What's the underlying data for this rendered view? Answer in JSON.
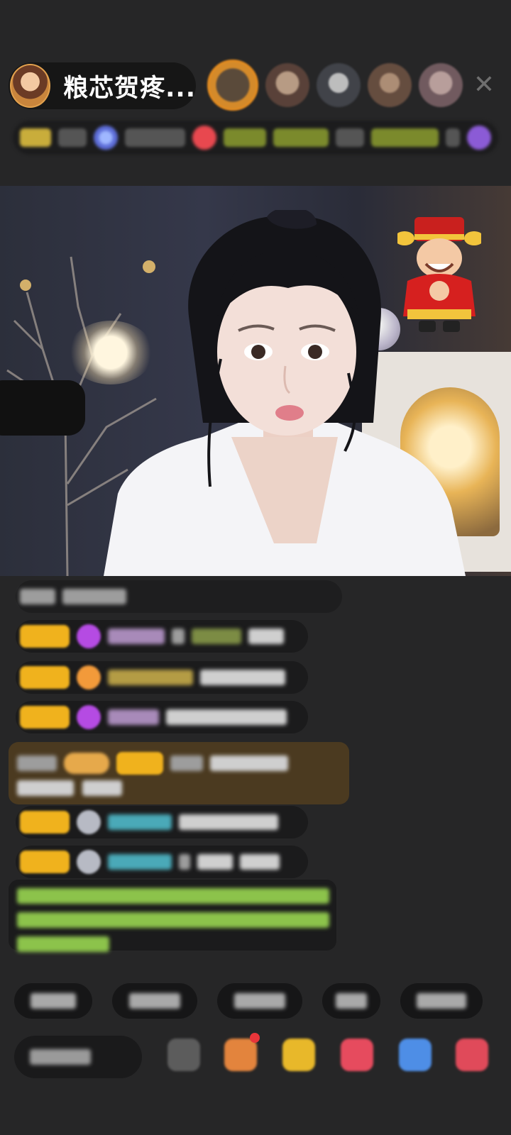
{
  "header": {
    "host_name": "粮芯贺疼...",
    "close_glyph": "✕"
  },
  "viewers": [
    "viewer-1",
    "viewer-2",
    "viewer-3",
    "viewer-4",
    "viewer-5"
  ],
  "colors": {
    "background": "#262627",
    "level_badge": "#f0b21d",
    "highlight_message": "#4b3a20",
    "close": "#8e8e8e"
  },
  "icons": {
    "close": "close-icon",
    "mascot": "god-of-wealth-sticker",
    "mic": "microphone"
  }
}
